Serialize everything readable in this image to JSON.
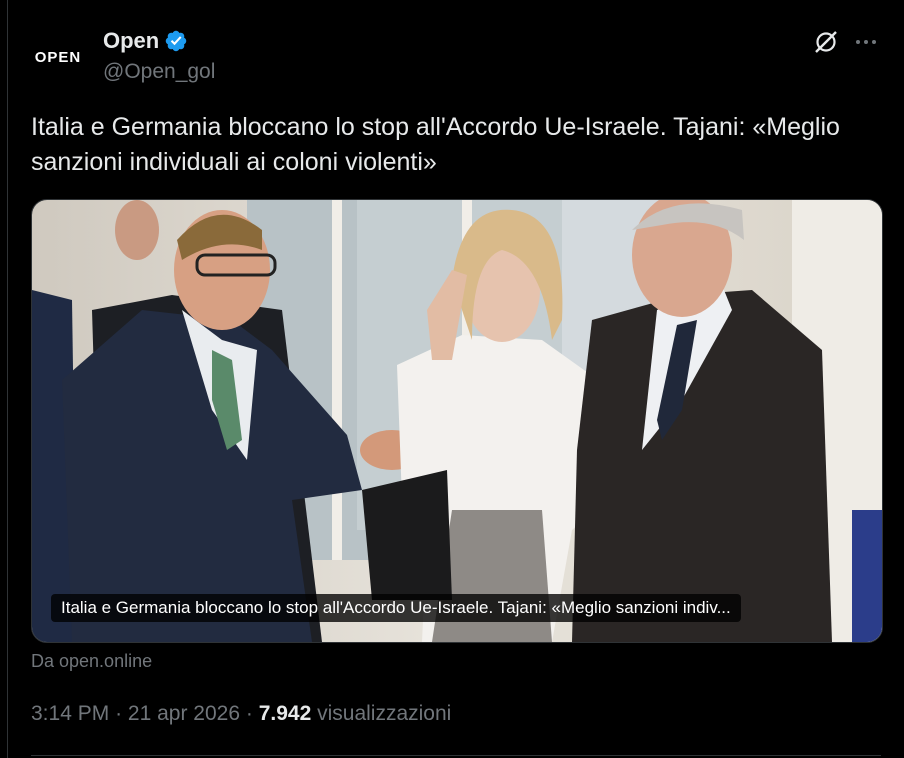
{
  "author": {
    "avatar_text": "OPEN",
    "display_name": "Open",
    "handle": "@Open_gol"
  },
  "icons": {
    "verified": "verified-badge-icon",
    "grok": "grok-icon",
    "more": "more-options-icon"
  },
  "tweet": {
    "text": "Italia e Germania bloccano lo stop all'Accordo Ue-Israele. Tajani: «Meglio sanzioni individuali ai coloni violenti»",
    "media_caption": "Italia e Germania bloccano lo stop all'Accordo Ue-Israele. Tajani: «Meglio sanzioni indiv...",
    "source": "Da open.online"
  },
  "meta": {
    "time": "3:14 PM",
    "separator": "·",
    "date": "21 apr 2026",
    "views_count": "7.942",
    "views_label": "visualizzazioni"
  },
  "colors": {
    "background": "#000000",
    "text": "#e7e9ea",
    "muted": "#71767b",
    "verified": "#1d9bf0"
  }
}
